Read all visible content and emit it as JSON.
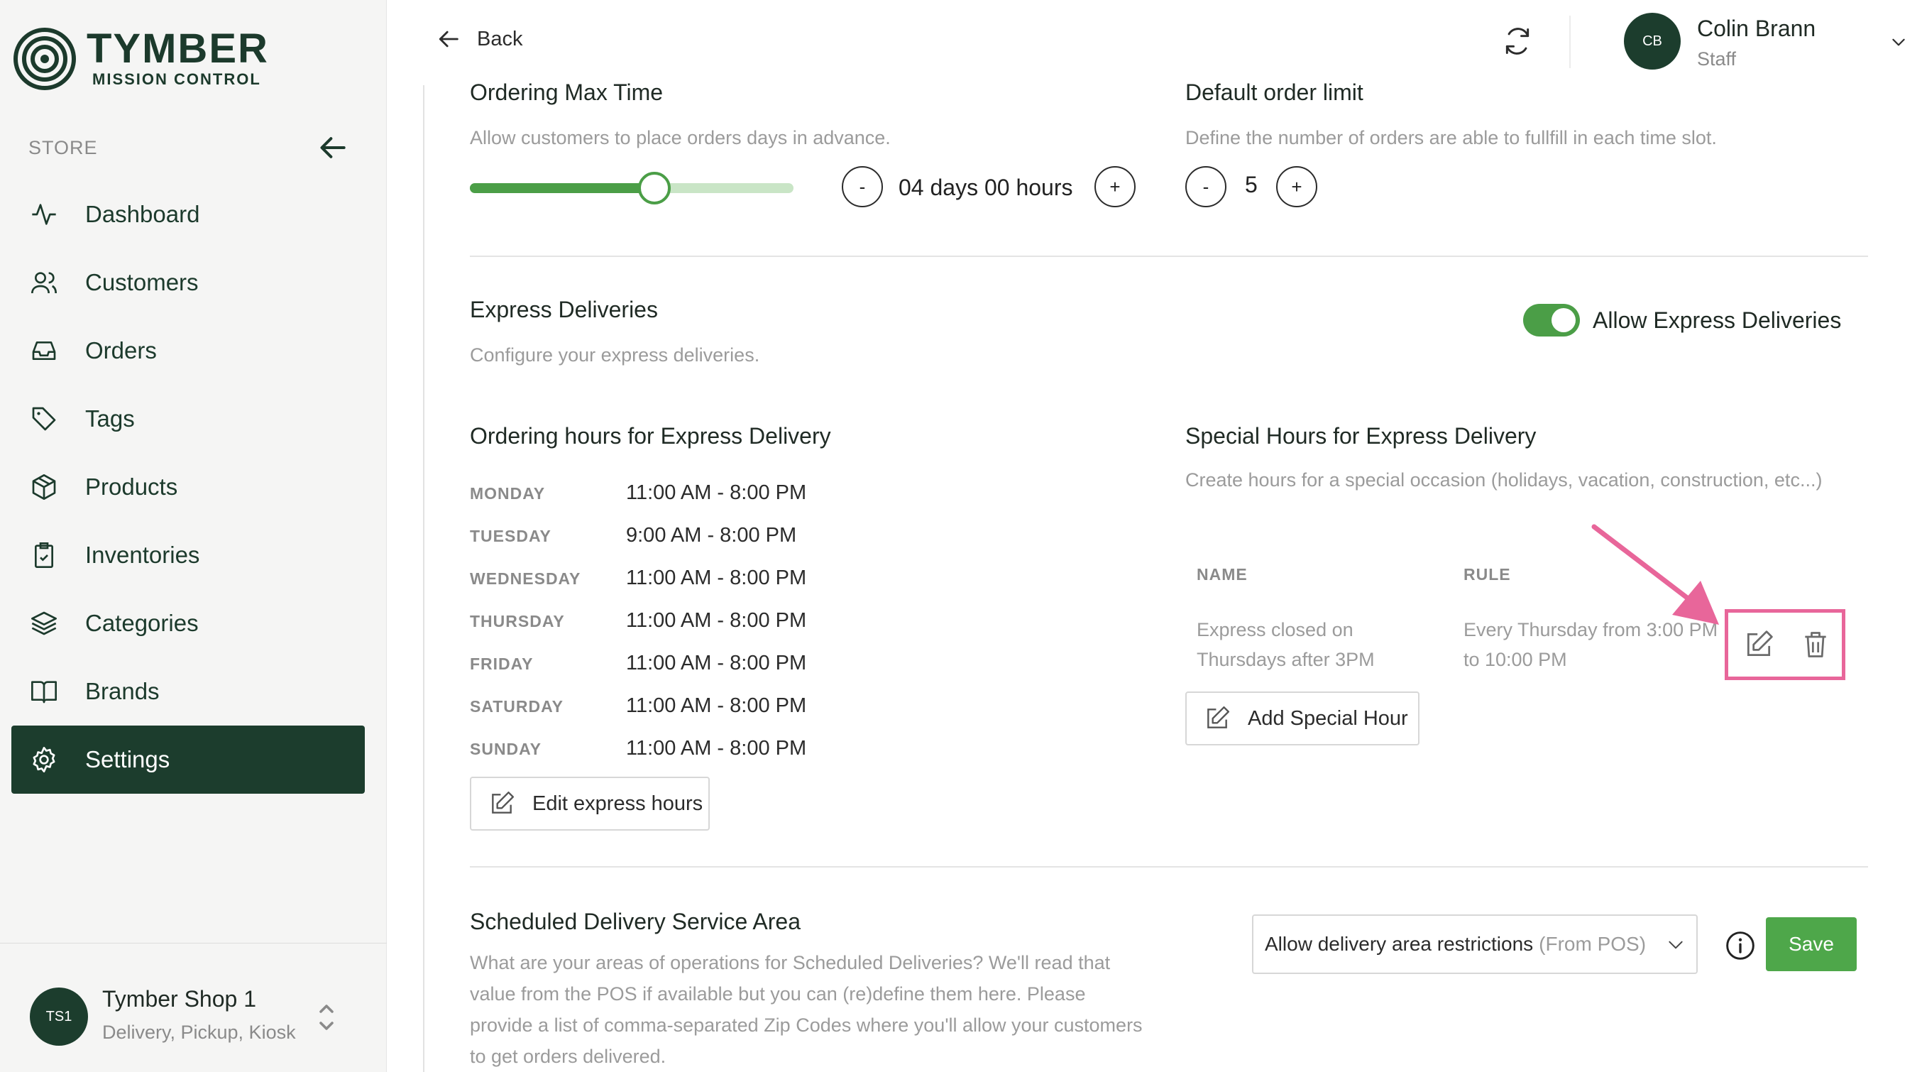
{
  "brand": {
    "title": "TYMBER",
    "subtitle": "MISSION CONTROL"
  },
  "sidebar": {
    "section_label": "STORE",
    "items": [
      {
        "label": "Dashboard",
        "icon": "activity-icon"
      },
      {
        "label": "Customers",
        "icon": "users-icon"
      },
      {
        "label": "Orders",
        "icon": "inbox-icon"
      },
      {
        "label": "Tags",
        "icon": "tag-icon"
      },
      {
        "label": "Products",
        "icon": "box-icon"
      },
      {
        "label": "Inventories",
        "icon": "clipboard-check-icon"
      },
      {
        "label": "Categories",
        "icon": "layers-icon"
      },
      {
        "label": "Brands",
        "icon": "book-open-icon"
      },
      {
        "label": "Settings",
        "icon": "gear-icon",
        "active": true
      }
    ],
    "shop": {
      "initials": "TS1",
      "name": "Tymber Shop 1",
      "type": "Delivery, Pickup, Kiosk"
    }
  },
  "header": {
    "back_label": "Back",
    "user": {
      "initials": "CB",
      "name": "Colin Brann",
      "role": "Staff"
    }
  },
  "ordering_max_time": {
    "title": "Ordering Max Time",
    "description": "Allow customers to place orders days in advance.",
    "value": "04 days 00 hours",
    "slider_fraction": 0.57,
    "minus": "-",
    "plus": "+"
  },
  "default_order_limit": {
    "title": "Default order limit",
    "description": "Define the number of orders are able to fullfill in each time slot.",
    "value": "5",
    "minus": "-",
    "plus": "+"
  },
  "express": {
    "title": "Express Deliveries",
    "description": "Configure your express deliveries.",
    "toggle_label": "Allow Express Deliveries",
    "toggle_on": true,
    "hours_title": "Ordering hours for Express Delivery",
    "hours": [
      {
        "day": "MONDAY",
        "time": "11:00 AM - 8:00 PM"
      },
      {
        "day": "TUESDAY",
        "time": "9:00 AM - 8:00 PM"
      },
      {
        "day": "WEDNESDAY",
        "time": "11:00 AM - 8:00 PM"
      },
      {
        "day": "THURSDAY",
        "time": "11:00 AM - 8:00 PM"
      },
      {
        "day": "FRIDAY",
        "time": "11:00 AM - 8:00 PM"
      },
      {
        "day": "SATURDAY",
        "time": "11:00 AM - 8:00 PM"
      },
      {
        "day": "SUNDAY",
        "time": "11:00 AM - 8:00 PM"
      }
    ],
    "edit_hours_label": "Edit express hours",
    "special_title": "Special Hours for Express Delivery",
    "special_description": "Create hours for a special occasion (holidays, vacation, construction, etc...)",
    "special_columns": [
      "NAME",
      "RULE"
    ],
    "special_rows": [
      {
        "name": "Express closed on Thursdays after 3PM",
        "rule": "Every Thursday from 3:00 PM to 10:00 PM"
      }
    ],
    "add_special_label": "Add Special Hour"
  },
  "service_area": {
    "title": "Scheduled Delivery Service Area",
    "description": "What are your areas of operations for Scheduled Deliveries? We'll read that value from the POS if available but you can (re)define them here. Please provide a list of comma-separated Zip Codes where you'll allow your customers to get orders delivered.",
    "select_value": "Allow delivery area restrictions",
    "select_hint": "(From POS)",
    "save_label": "Save"
  },
  "colors": {
    "brand_dark": "#1c3d2d",
    "accent_green": "#4ea74a",
    "highlight_pink": "#e8669a"
  }
}
